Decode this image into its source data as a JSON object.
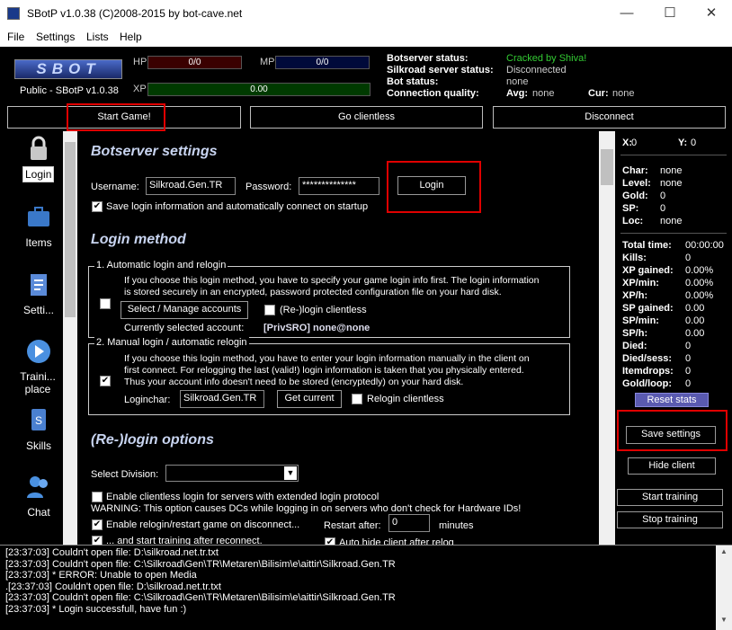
{
  "window": {
    "title": "SBotP v1.0.38 (C)2008-2015 by bot-cave.net",
    "min": "—",
    "max": "☐",
    "close": "✕"
  },
  "menu": [
    "File",
    "Settings",
    "Lists",
    "Help"
  ],
  "header": {
    "logo": "SBOT",
    "version": "Public - SBotP v1.0.38",
    "hp_label": "HP",
    "hp_value": "0/0",
    "mp_label": "MP",
    "mp_value": "0/0",
    "xp_label": "XP",
    "xp_value": "0.00",
    "botserver_status_label": "Botserver status:",
    "botserver_status_value": "Cracked by Shiva!",
    "silkroad_status_label": "Silkroad server status:",
    "silkroad_status_value": "Disconnected",
    "bot_status_label": "Bot status:",
    "bot_status_value": "none",
    "conn_label": "Connection quality:",
    "avg_label": "Avg:",
    "avg_value": "none",
    "cur_label": "Cur:",
    "cur_value": "none",
    "colors": {
      "status_ok": "#33cc33",
      "hp_bar": "#3a0000",
      "mp_bar": "#000a3a",
      "xp_bar": "#003a00"
    }
  },
  "actions": {
    "start_game": "Start Game!",
    "go_clientless": "Go clientless",
    "disconnect": "Disconnect"
  },
  "sidebar": [
    {
      "label": "Login",
      "icon": "lock-icon"
    },
    {
      "label": "Items",
      "icon": "briefcase-icon"
    },
    {
      "label": "Setti...",
      "icon": "notepad-icon"
    },
    {
      "label": "Traini... place",
      "icon": "play-icon"
    },
    {
      "label": "Skills",
      "icon": "book-icon"
    },
    {
      "label": "Chat",
      "icon": "people-icon"
    }
  ],
  "botserver": {
    "heading": "Botserver settings",
    "username_label": "Username:",
    "username_value": "Silkroad.Gen.TR",
    "password_label": "Password:",
    "password_value": "**************",
    "login_btn": "Login",
    "save_login": "Save login information and automatically connect on startup"
  },
  "login_method": {
    "heading": "Login method",
    "auto_title": "1. Automatic login and relogin",
    "auto_desc1": "If you choose this login method, you have to specify your game login info first. The login information",
    "auto_desc2": "is stored securely in an encrypted, password protected configuration file on your hard disk.",
    "select_accounts_btn": "Select / Manage accounts",
    "relogin_clientless": "(Re-)login clientless",
    "current_account_label": "Currently selected account:",
    "current_account_value": "[PrivSRO] none@none",
    "manual_title": "2. Manual login / automatic relogin",
    "manual_desc1": "If you choose this login method, you have to enter your login information manually in the client on",
    "manual_desc2": "first connect. For relogging the last (valid!) login information is taken that you physically entered.",
    "manual_desc3": "Thus your account info doesn't need to be stored (encryptedly) on your hard disk.",
    "loginchar_label": "Loginchar:",
    "loginchar_value": "Silkroad.Gen.TR",
    "get_current_btn": "Get current",
    "relogin_clientless2": "Relogin clientless"
  },
  "relogin": {
    "heading": "(Re-)login options",
    "division_label": "Select Division:",
    "division_value": "",
    "enable_clientless": "Enable clientless login for servers with extended login protocol",
    "warning": "WARNING: This option causes DCs while logging in on servers who don't check for Hardware IDs!",
    "enable_relogin": "Enable relogin/restart game on disconnect...",
    "restart_after_label": "Restart after:",
    "restart_after_value": "0",
    "minutes": "minutes",
    "start_training_after": "... and start training after reconnect.",
    "auto_hide": "Auto hide client after relog"
  },
  "stats": {
    "x_label": "X:",
    "x_value": "0",
    "y_label": "Y:",
    "y_value": "0",
    "char_label": "Char:",
    "char_value": "none",
    "level_label": "Level:",
    "level_value": "none",
    "gold_label": "Gold:",
    "gold_value": "0",
    "sp_label": "SP:",
    "sp_value": "0",
    "loc_label": "Loc:",
    "loc_value": "none",
    "rows": [
      [
        "Total time:",
        "00:00:00"
      ],
      [
        "Kills:",
        "0"
      ],
      [
        "XP gained:",
        "0.00%"
      ],
      [
        "XP/min:",
        "0.00%"
      ],
      [
        "XP/h:",
        "0.00%"
      ],
      [
        "SP gained:",
        "0.00"
      ],
      [
        "SP/min:",
        "0.00"
      ],
      [
        "SP/h:",
        "0.00"
      ],
      [
        "Died:",
        "0"
      ],
      [
        "Died/sess:",
        "0"
      ],
      [
        "Itemdrops:",
        "0"
      ],
      [
        "Gold/loop:",
        "0"
      ]
    ],
    "reset_btn": "Reset stats",
    "save_btn": "Save settings",
    "hide_btn": "Hide client",
    "start_training_btn": "Start training",
    "stop_training_btn": "Stop training"
  },
  "log": [
    "[23:37:03] Couldn't open file: D:\\silkroad.net.tr.txt",
    "[23:37:03] Couldn't open file: C:\\Silkroad\\Gen\\TR\\Metaren\\Bilisim\\e\\aittir\\Silkroad.Gen.TR",
    "[23:37:03] * ERROR: Unable to open Media",
    ".[23:37:03] Couldn't open file: D:\\silkroad.net.tr.txt",
    "[23:37:03] Couldn't open file: C:\\Silkroad\\Gen\\TR\\Metaren\\Bilisim\\e\\aittir\\Silkroad.Gen.TR",
    "[23:37:03] * Login successfull, have fun :)"
  ]
}
